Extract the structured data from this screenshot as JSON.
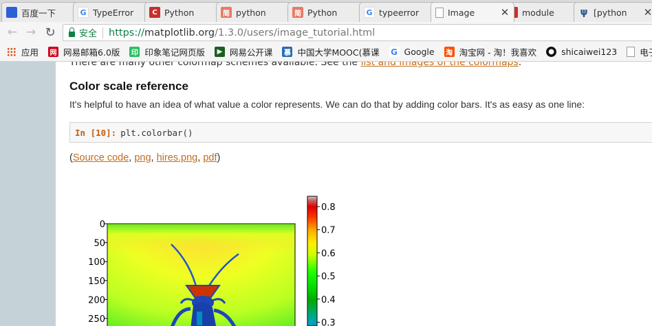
{
  "tabs": [
    {
      "title": "百度一下",
      "icon": "baidu-paw-icon",
      "icon_glyph": "🐾",
      "active": false
    },
    {
      "title": "TypeError",
      "icon": "google-icon",
      "icon_glyph": "G",
      "active": false
    },
    {
      "title": "Python",
      "icon": "csdn-icon",
      "icon_glyph": "C",
      "active": false
    },
    {
      "title": "python",
      "icon": "jianshu-icon",
      "icon_glyph": "简",
      "active": false
    },
    {
      "title": "Python",
      "icon": "jianshu-icon",
      "icon_glyph": "简",
      "active": false
    },
    {
      "title": "typeerror",
      "icon": "google-icon",
      "icon_glyph": "G",
      "active": false
    },
    {
      "title": "Image",
      "icon": "document-icon",
      "icon_glyph": "",
      "active": true
    },
    {
      "title": "module",
      "icon": "csdn-icon",
      "icon_glyph": "C",
      "active": false
    },
    {
      "title": "[python",
      "icon": "python-logo-icon",
      "icon_glyph": "ψ",
      "active": false
    }
  ],
  "tab_close_glyph": "✕",
  "nav": {
    "back": "←",
    "forward": "→",
    "reload": "↻"
  },
  "address": {
    "secure_label": "安全",
    "url_proto": "https://",
    "url_host": "matplotlib.org",
    "url_path": "/1.3.0/users/image_tutorial.html"
  },
  "bookmarks": [
    {
      "label": "应用",
      "icon": "apps-grid-icon"
    },
    {
      "label": "网易邮箱6.0版",
      "icon": "netease-mail-icon"
    },
    {
      "label": "印象笔记网页版",
      "icon": "evernote-icon"
    },
    {
      "label": "网易公开课",
      "icon": "netease-open-course-icon"
    },
    {
      "label": "中国大学MOOC(慕课",
      "icon": "mooc-icon"
    },
    {
      "label": "Google",
      "icon": "google-icon"
    },
    {
      "label": "淘宝网 - 淘！我喜欢",
      "icon": "taobao-icon"
    },
    {
      "label": "shicaiwei123",
      "icon": "github-icon"
    },
    {
      "label": "电子科",
      "icon": "document-icon"
    }
  ],
  "colors": {
    "link": "#c06d1d",
    "secure_green": "#0b8043",
    "prompt_orange": "#c65d09",
    "sidebar_bg": "#c5d3d9"
  },
  "article": {
    "cutoff_text": "There are many other colormap schemes available. See the ",
    "cutoff_link": "list and images of the colormaps",
    "cutoff_end": ".",
    "heading": "Color scale reference",
    "paragraph": "It's helpful to have an idea of what value a color represents. We can do that by adding color bars. It's as easy as one line:",
    "code_prompt": "In [10]:",
    "code": "plt.colorbar()",
    "links_open": "(",
    "links": [
      "Source code",
      "png",
      "hires.png",
      "pdf"
    ],
    "links_sep": ", ",
    "links_close": ")"
  },
  "chart_data": {
    "type": "heatmap",
    "image_description_free": true,
    "y_ticks": [
      0,
      50,
      100,
      150,
      200,
      250
    ],
    "colorbar_ticks": [
      0.8,
      0.7,
      0.6,
      0.5,
      0.4,
      0.3
    ],
    "colormap": "nipy_spectral"
  }
}
